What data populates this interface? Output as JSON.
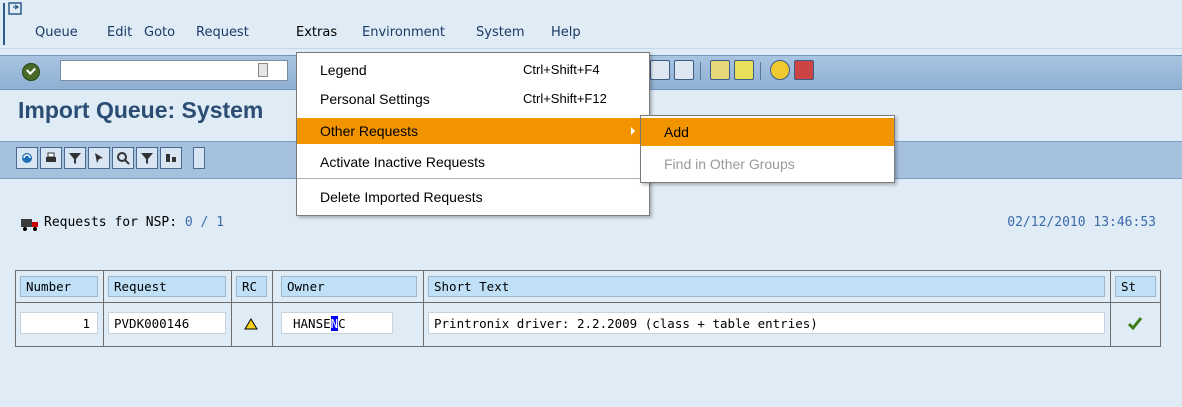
{
  "menubar": {
    "items": [
      "Queue",
      "Edit",
      "Goto",
      "Request",
      "Extras",
      "Environment",
      "System",
      "Help"
    ]
  },
  "page": {
    "title": "Import Queue: System"
  },
  "status": {
    "label": "Requests for NSP:",
    "count": "0 / 1",
    "timestamp": "02/12/2010 13:46:53"
  },
  "table": {
    "columns": [
      "Number",
      "Request",
      "RC",
      "Owner",
      "Short Text",
      "St"
    ],
    "rows": [
      {
        "number": "1",
        "request": "PVDK000146",
        "rc_icon": "warning-triangle-icon",
        "owner_prefix": "HANSE",
        "owner_highlight": "N",
        "owner_suffix": "C",
        "short_text": "Printronix driver: 2.2.2009 (class + table entries)",
        "st_icon": "checkmark-icon"
      }
    ]
  },
  "extras_menu": {
    "items": [
      {
        "label": "Legend",
        "shortcut": "Ctrl+Shift+F4"
      },
      {
        "label": "Personal Settings",
        "shortcut": "Ctrl+Shift+F12"
      },
      {
        "label": "Other Requests",
        "shortcut": ""
      },
      {
        "label": "Activate Inactive Requests",
        "shortcut": ""
      },
      {
        "label": "Delete Imported Requests",
        "shortcut": ""
      }
    ]
  },
  "submenu": {
    "items": [
      {
        "label": "Add",
        "enabled": true
      },
      {
        "label": "Find in Other Groups",
        "enabled": false
      }
    ]
  },
  "colors": {
    "highlight": "#f29400",
    "title": "#2b4c73",
    "link": "#3d6ba8"
  }
}
